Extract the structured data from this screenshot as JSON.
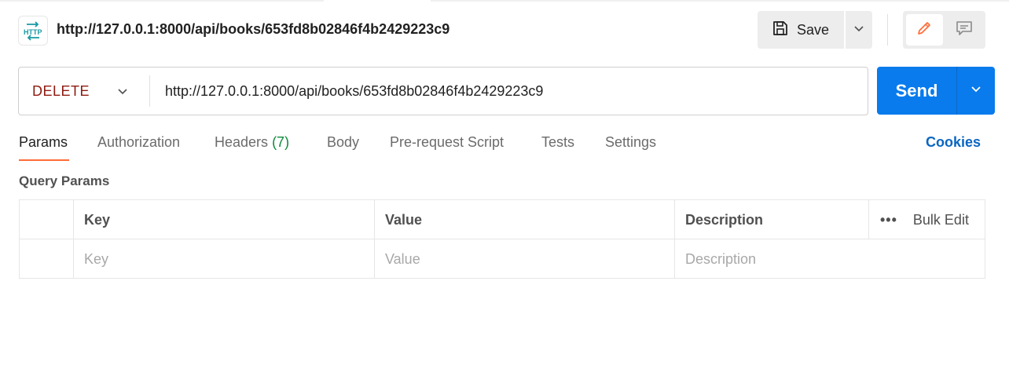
{
  "request": {
    "icon": "http-icon",
    "title": "http://127.0.0.1:8000/api/books/653fd8b02846f4b2429223c9",
    "method": "DELETE",
    "url": "http://127.0.0.1:8000/api/books/653fd8b02846f4b2429223c9"
  },
  "toolbar": {
    "save_label": "Save",
    "send_label": "Send"
  },
  "tabs": [
    {
      "label": "Params",
      "active": true
    },
    {
      "label": "Authorization"
    },
    {
      "label": "Headers",
      "count": "(7)"
    },
    {
      "label": "Body"
    },
    {
      "label": "Pre-request Script"
    },
    {
      "label": "Tests"
    },
    {
      "label": "Settings"
    }
  ],
  "cookies_label": "Cookies",
  "query_params": {
    "title": "Query Params",
    "columns": [
      "Key",
      "Value",
      "Description"
    ],
    "bulk_edit_label": "Bulk Edit",
    "more_label": "•••",
    "placeholders": {
      "key": "Key",
      "value": "Value",
      "description": "Description"
    }
  },
  "colors": {
    "send": "#097bed",
    "method": "#8e1a10",
    "active_tab_underline": "#ff6c37",
    "cookies": "#0a66c2",
    "headers_count": "#0d8a3a"
  }
}
